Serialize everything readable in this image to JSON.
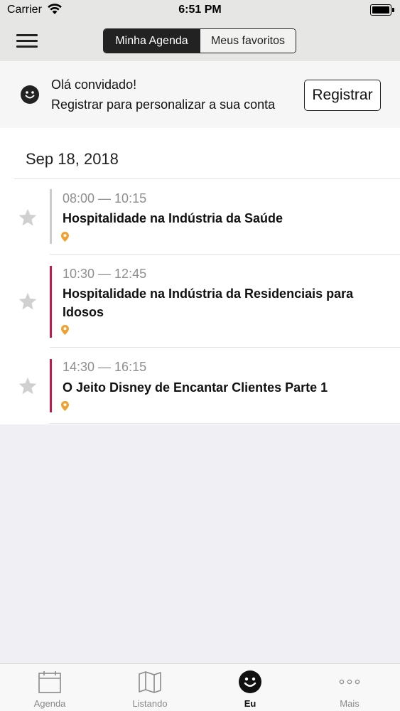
{
  "status_bar": {
    "carrier": "Carrier",
    "time": "6:51 PM"
  },
  "nav": {
    "segments": [
      "Minha Agenda",
      "Meus favoritos"
    ],
    "selected_segment": "Minha Agenda"
  },
  "guest": {
    "title": "Olá convidado!",
    "subtitle": "Registrar para personalizar a sua conta",
    "register_label": "Registrar"
  },
  "schedule": {
    "date": "Sep 18, 2018",
    "sessions": [
      {
        "time": "08:00 — 10:15",
        "title": "Hospitalidade na Indústria da Saúde",
        "accent_color": "#cccccc",
        "starred": false
      },
      {
        "time": "10:30 — 12:45",
        "title": "Hospitalidade na Indústria da Residenciais para Idosos",
        "accent_color": "#c8184a",
        "starred": false
      },
      {
        "time": "14:30 — 16:15",
        "title": "O Jeito Disney de Encantar Clientes Parte 1",
        "accent_color": "#c8184a",
        "starred": false
      }
    ]
  },
  "tabs": [
    {
      "label": "Agenda",
      "icon": "calendar-icon",
      "active": false
    },
    {
      "label": "Listando",
      "icon": "map-icon",
      "active": false
    },
    {
      "label": "Eu",
      "icon": "smiley-icon",
      "active": true
    },
    {
      "label": "Mais",
      "icon": "more-icon",
      "active": false
    }
  ],
  "colors": {
    "pin": "#f0a030",
    "star": "#d0d0d0",
    "accent_pink": "#c8184a"
  }
}
